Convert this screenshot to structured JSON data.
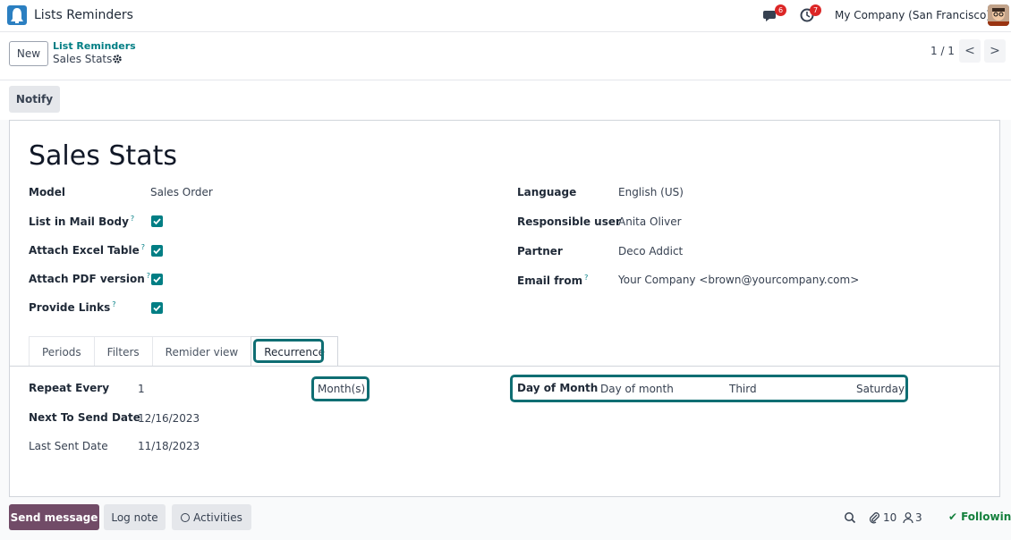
{
  "topbar": {
    "app_title": "Lists Reminders",
    "messages_count": "6",
    "activities_count": "7",
    "company": "My Company (San Francisco)"
  },
  "control": {
    "new_label": "New",
    "breadcrumb_parent": "List Reminders",
    "breadcrumb_current": "Sales Stats",
    "pager": "1 / 1",
    "prev_label": "<",
    "next_label": ">"
  },
  "actions": {
    "notify_label": "Notify"
  },
  "record": {
    "title": "Sales Stats",
    "left_fields": [
      {
        "label": "Model",
        "value": "Sales Order"
      },
      {
        "label": "List in Mail Body",
        "checked": true
      },
      {
        "label": "Attach Excel Table",
        "checked": true
      },
      {
        "label": "Attach PDF version",
        "checked": true
      },
      {
        "label": "Provide Links",
        "checked": true
      }
    ],
    "right_fields": [
      {
        "label": "Language",
        "value": "English (US)"
      },
      {
        "label": "Responsible user",
        "value": "Anita Oliver"
      },
      {
        "label": "Partner",
        "value": "Deco Addict"
      },
      {
        "label": "Email from",
        "value": "Your Company <brown@yourcompany.com>"
      }
    ],
    "help_mark": "?"
  },
  "tabs": [
    "Periods",
    "Filters",
    "Remider view",
    "Recurrence"
  ],
  "recurrence": {
    "repeat_label": "Repeat Every",
    "repeat_value": "1",
    "repeat_unit": "Month(s)",
    "next_label": "Next To Send Date",
    "next_value": "12/16/2023",
    "last_label": "Last Sent Date",
    "last_value": "11/18/2023",
    "day_label": "Day of Month",
    "day_mode": "Day of month",
    "day_ordinal": "Third",
    "day_weekday": "Saturday"
  },
  "chatter": {
    "send_label": "Send message",
    "log_label": "Log note",
    "activities_label": "Activities",
    "attachments_count": "10",
    "followers_count": "3",
    "following_label": "Following"
  },
  "colors": {
    "accent": "#017e84",
    "highlight": "#0f6e73",
    "primary": "#714b67",
    "badge": "#dc2626"
  }
}
